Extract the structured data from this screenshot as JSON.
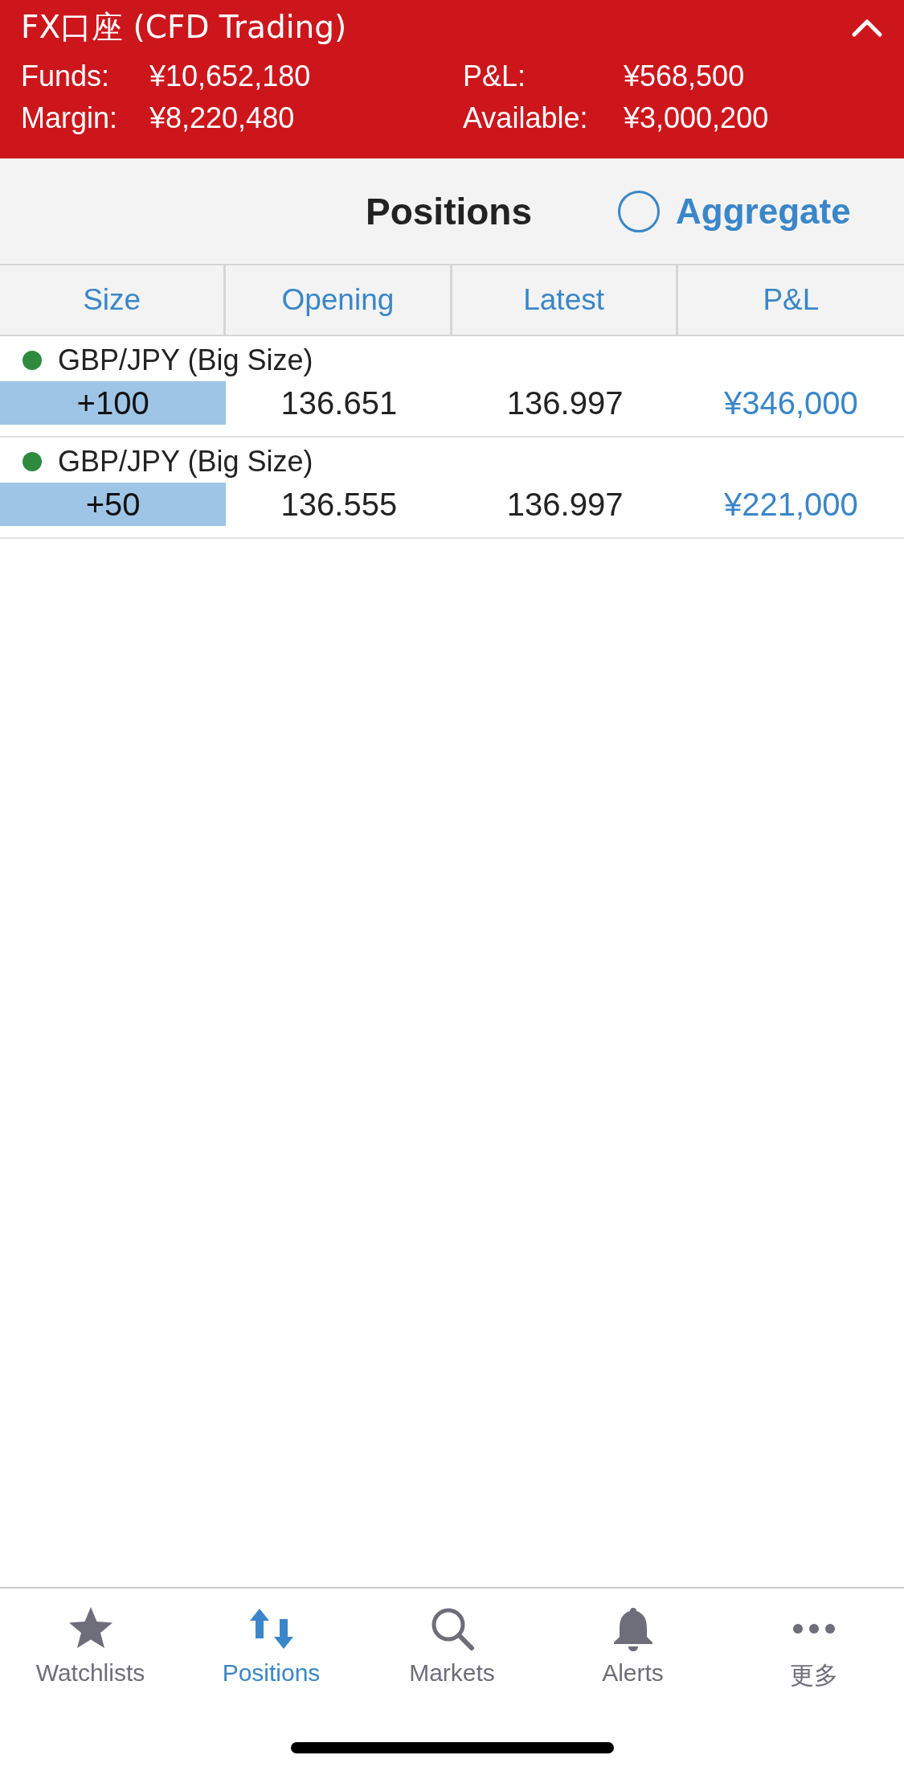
{
  "account": {
    "title": "FX口座 (CFD Trading)",
    "expanded": true,
    "summary": [
      {
        "label": "Funds:",
        "value": "¥10,652,180"
      },
      {
        "label": "P&L:",
        "value": "¥568,500"
      },
      {
        "label": "Margin:",
        "value": "¥8,220,480"
      },
      {
        "label": "Available:",
        "value": "¥3,000,200"
      }
    ]
  },
  "toolbar": {
    "title": "Positions",
    "aggregate": {
      "label": "Aggregate",
      "checked": false
    }
  },
  "table": {
    "columns": [
      "Size",
      "Opening",
      "Latest",
      "P&L"
    ],
    "rows": [
      {
        "name": "GBP/JPY (Big Size)",
        "color": "#2e8b3e",
        "size": "+100",
        "opening": "136.651",
        "latest": "136.997",
        "pnl": "¥346,000"
      },
      {
        "name": "GBP/JPY (Big Size)",
        "color": "#2e8b3e",
        "size": "+50",
        "opening": "136.555",
        "latest": "136.997",
        "pnl": "¥221,000"
      }
    ]
  },
  "tabs": [
    {
      "label": "Watchlists",
      "kind": "star",
      "selected": false
    },
    {
      "label": "Positions",
      "kind": "arrows",
      "selected": true
    },
    {
      "label": "Markets",
      "kind": "search",
      "selected": false
    },
    {
      "label": "Alerts",
      "kind": "bell",
      "selected": false
    },
    {
      "label": "更多",
      "kind": "more",
      "selected": false
    }
  ]
}
